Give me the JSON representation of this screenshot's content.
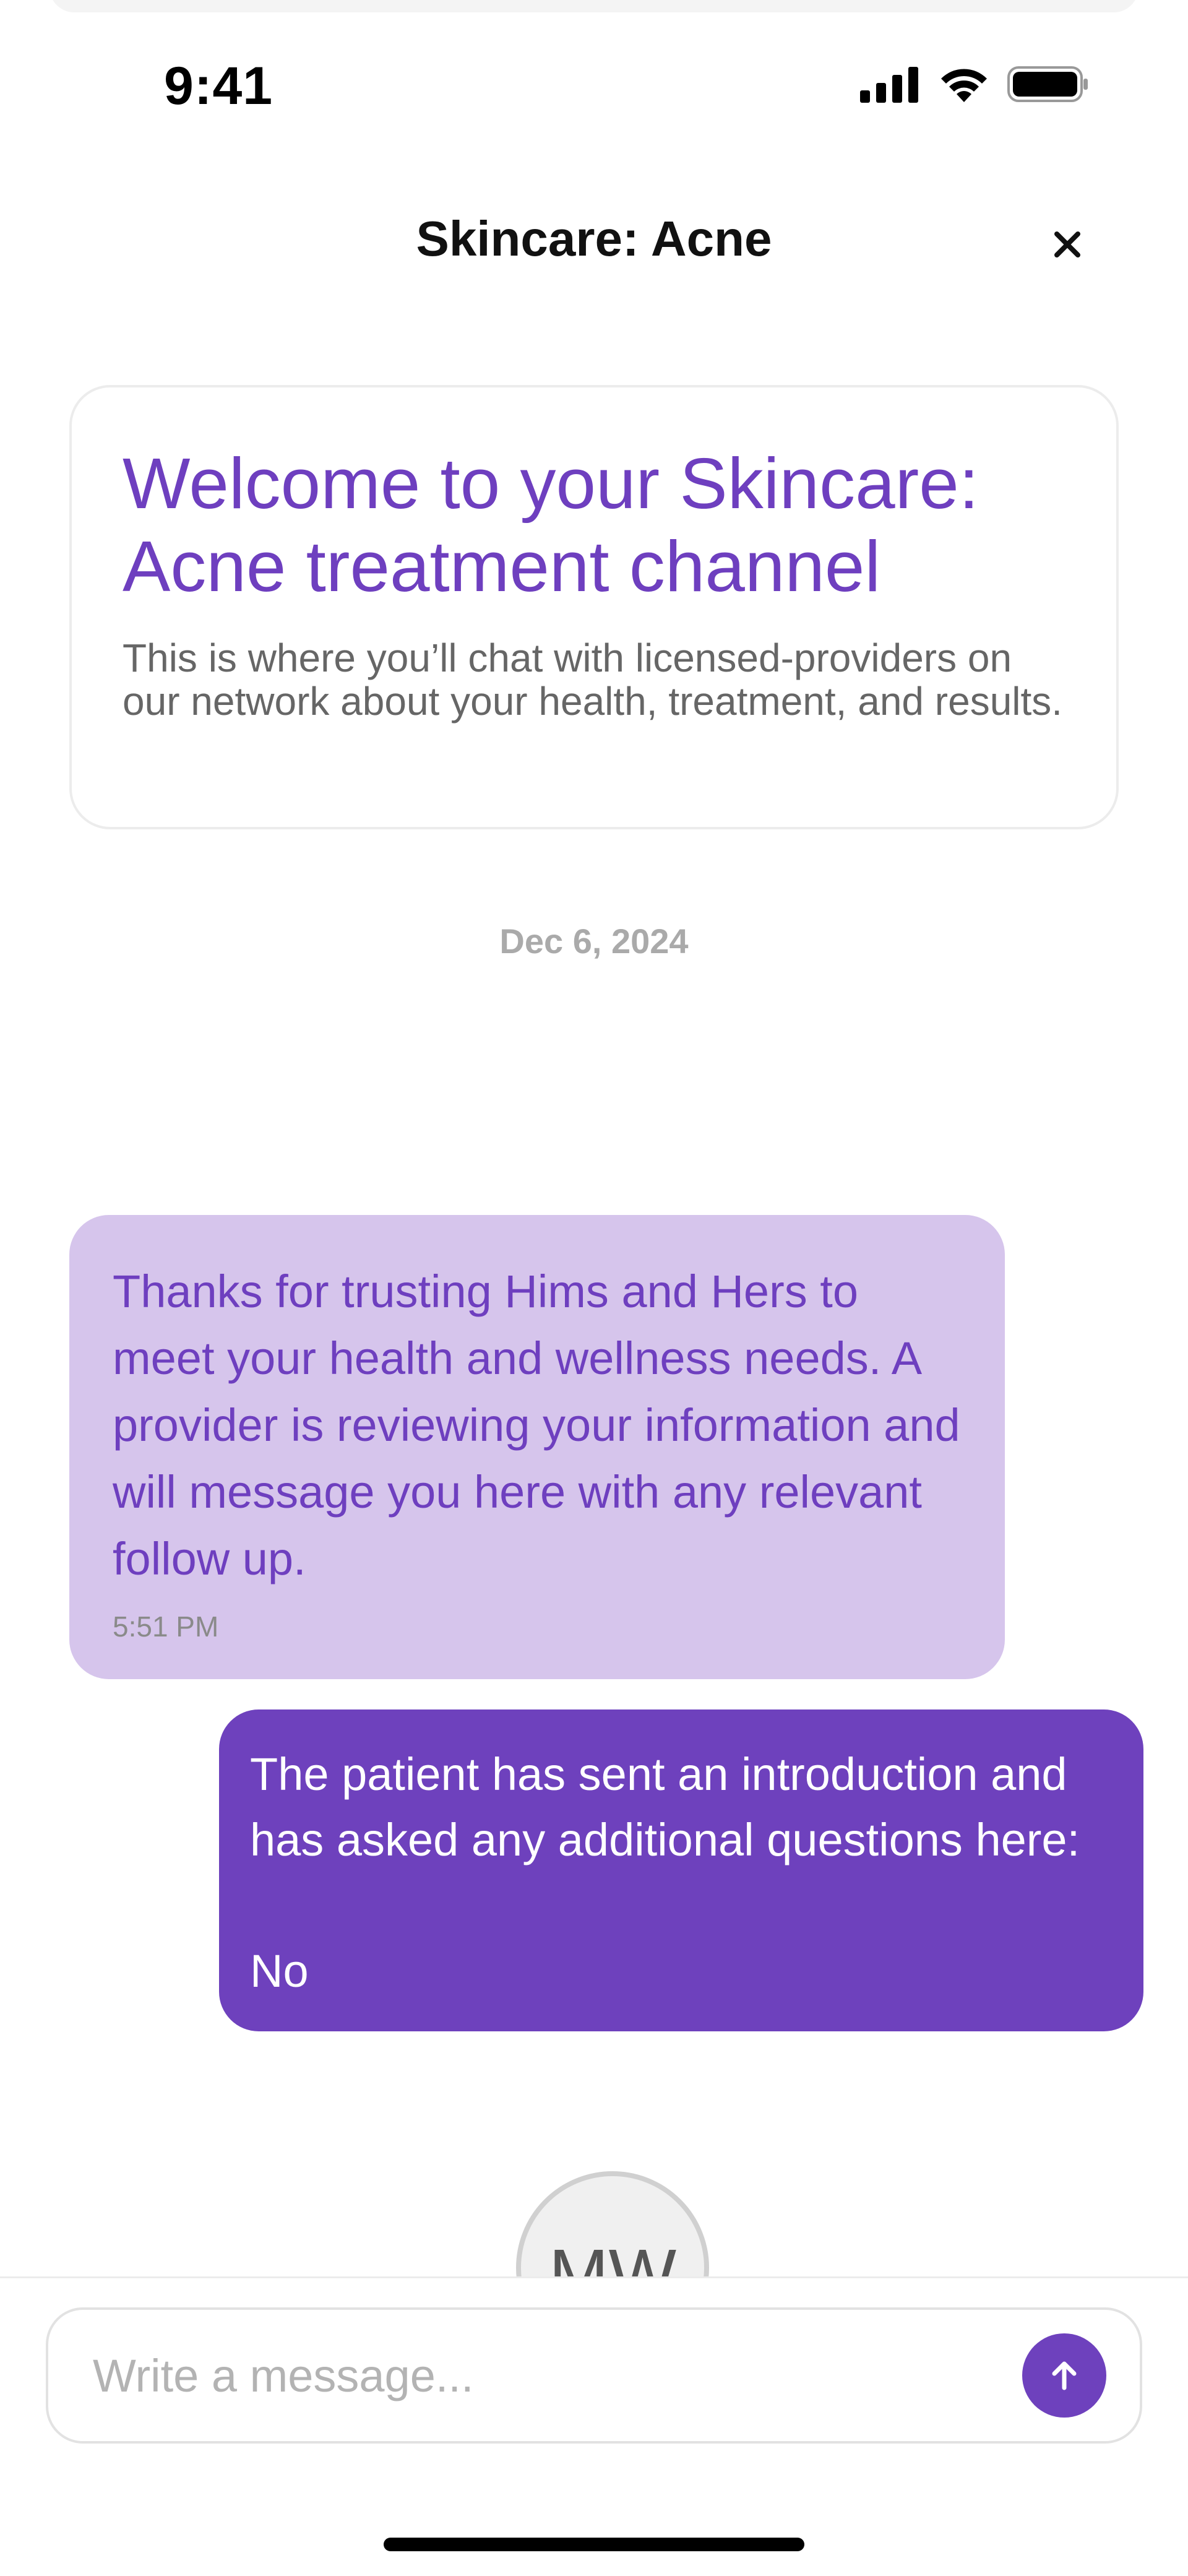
{
  "status_bar": {
    "time": "9:41",
    "icons": [
      "cellular-signal-icon",
      "wifi-icon",
      "battery-icon"
    ]
  },
  "header": {
    "title": "Skincare: Acne",
    "close_icon": "close-icon"
  },
  "welcome_card": {
    "title": "Welcome to your Skincare: Acne treatment channel",
    "description": "This is where you’ll chat with licensed-providers on our network about your health, treatment, and results."
  },
  "date_separator": "Dec 6, 2024",
  "messages": [
    {
      "direction": "incoming",
      "text": "Thanks for trusting Hims and Hers to meet your health and wellness needs. A provider is reviewing your information and will message you here with any relevant follow up.",
      "time": "5:51 PM"
    },
    {
      "direction": "outgoing",
      "text": "The patient has sent an introduction and has asked any additional questions here:\n\nNo"
    }
  ],
  "avatar": {
    "initials": "MW"
  },
  "composer": {
    "placeholder": "Write a message...",
    "value": "",
    "send_icon": "arrow-up-icon"
  },
  "colors": {
    "accent": "#6e41bd",
    "accent_text": "#6e3fbf",
    "incoming_bubble": "#d6c5ec",
    "muted": "#aaaaaa"
  }
}
